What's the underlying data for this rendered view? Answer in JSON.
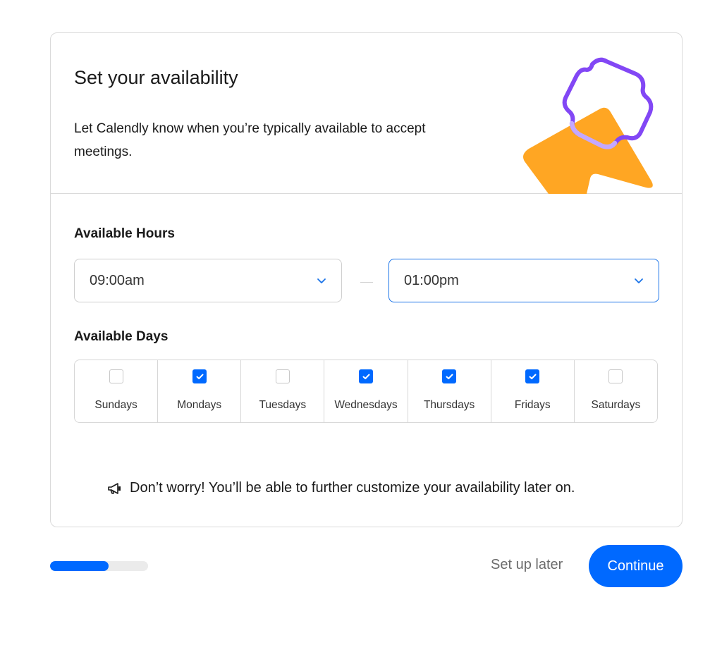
{
  "header": {
    "title": "Set your availability",
    "subtitle": "Let Calendly know when you’re typically available to accept meetings."
  },
  "hours": {
    "label": "Available Hours",
    "start": "09:00am",
    "end": "01:00pm"
  },
  "days": {
    "label": "Available Days",
    "items": [
      {
        "label": "Sundays",
        "checked": false
      },
      {
        "label": "Mondays",
        "checked": true
      },
      {
        "label": "Tuesdays",
        "checked": false
      },
      {
        "label": "Wednesdays",
        "checked": true
      },
      {
        "label": "Thursdays",
        "checked": true
      },
      {
        "label": "Fridays",
        "checked": true
      },
      {
        "label": "Saturdays",
        "checked": false
      }
    ]
  },
  "note": {
    "icon": "megaphone-icon",
    "text": "Don’t worry! You’ll be able to further customize your availability later on."
  },
  "footer": {
    "progress_percent": 60,
    "setup_later_label": "Set up later",
    "continue_label": "Continue"
  },
  "colors": {
    "accent": "#0069ff",
    "illustration_orange": "#ffa623",
    "illustration_purple": "#8247f5",
    "illustration_lilac": "#c4a8ff"
  }
}
